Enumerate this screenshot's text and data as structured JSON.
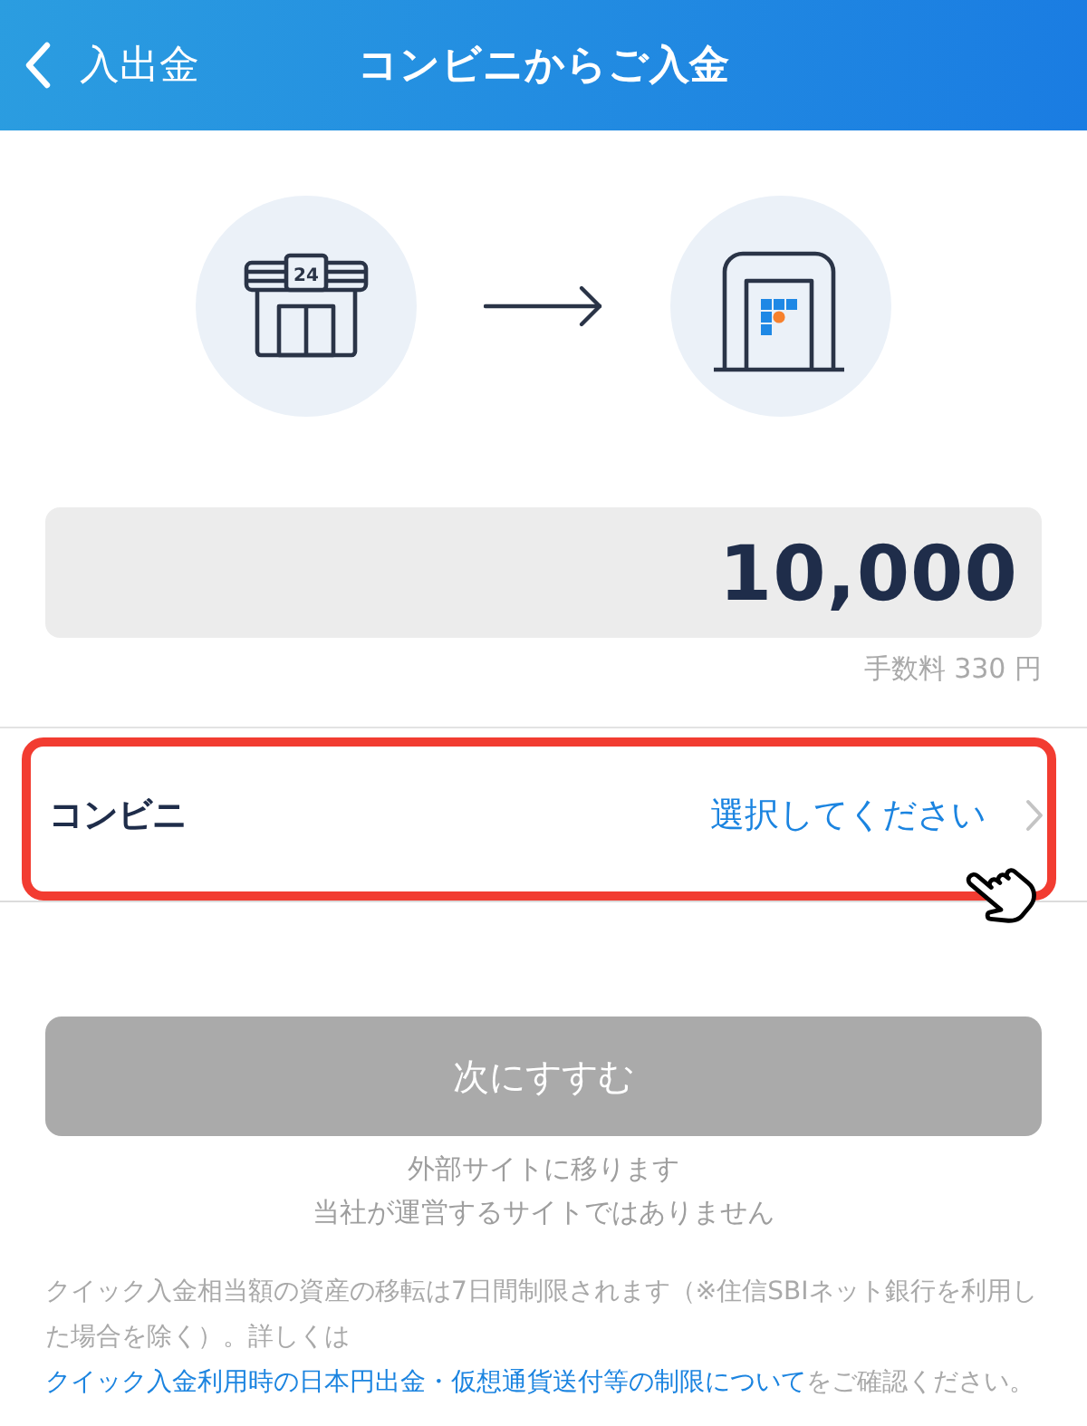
{
  "header": {
    "back_label": "入出金",
    "title": "コンビニからご入金"
  },
  "flow": {
    "store_sign": "24"
  },
  "amount": {
    "value": "10,000",
    "fee": "手数料 330 円"
  },
  "selector": {
    "label": "コンビニ",
    "value": "選択してください",
    "highlighted": true
  },
  "next_button": {
    "label": "次にすすむ",
    "disabled": true
  },
  "notes": [
    "外部サイトに移ります",
    "当社が運営するサイトではありません"
  ],
  "disclaimer": {
    "text_before": "クイック入金相当額の資産の移転は7日間制限されます（※住信SBIネット銀行を利用した場合を除く）。詳しくは",
    "link": "クイック入金利用時の日本円出金・仮想通貨送付等の制限について",
    "text_after": "をご確認ください。"
  }
}
